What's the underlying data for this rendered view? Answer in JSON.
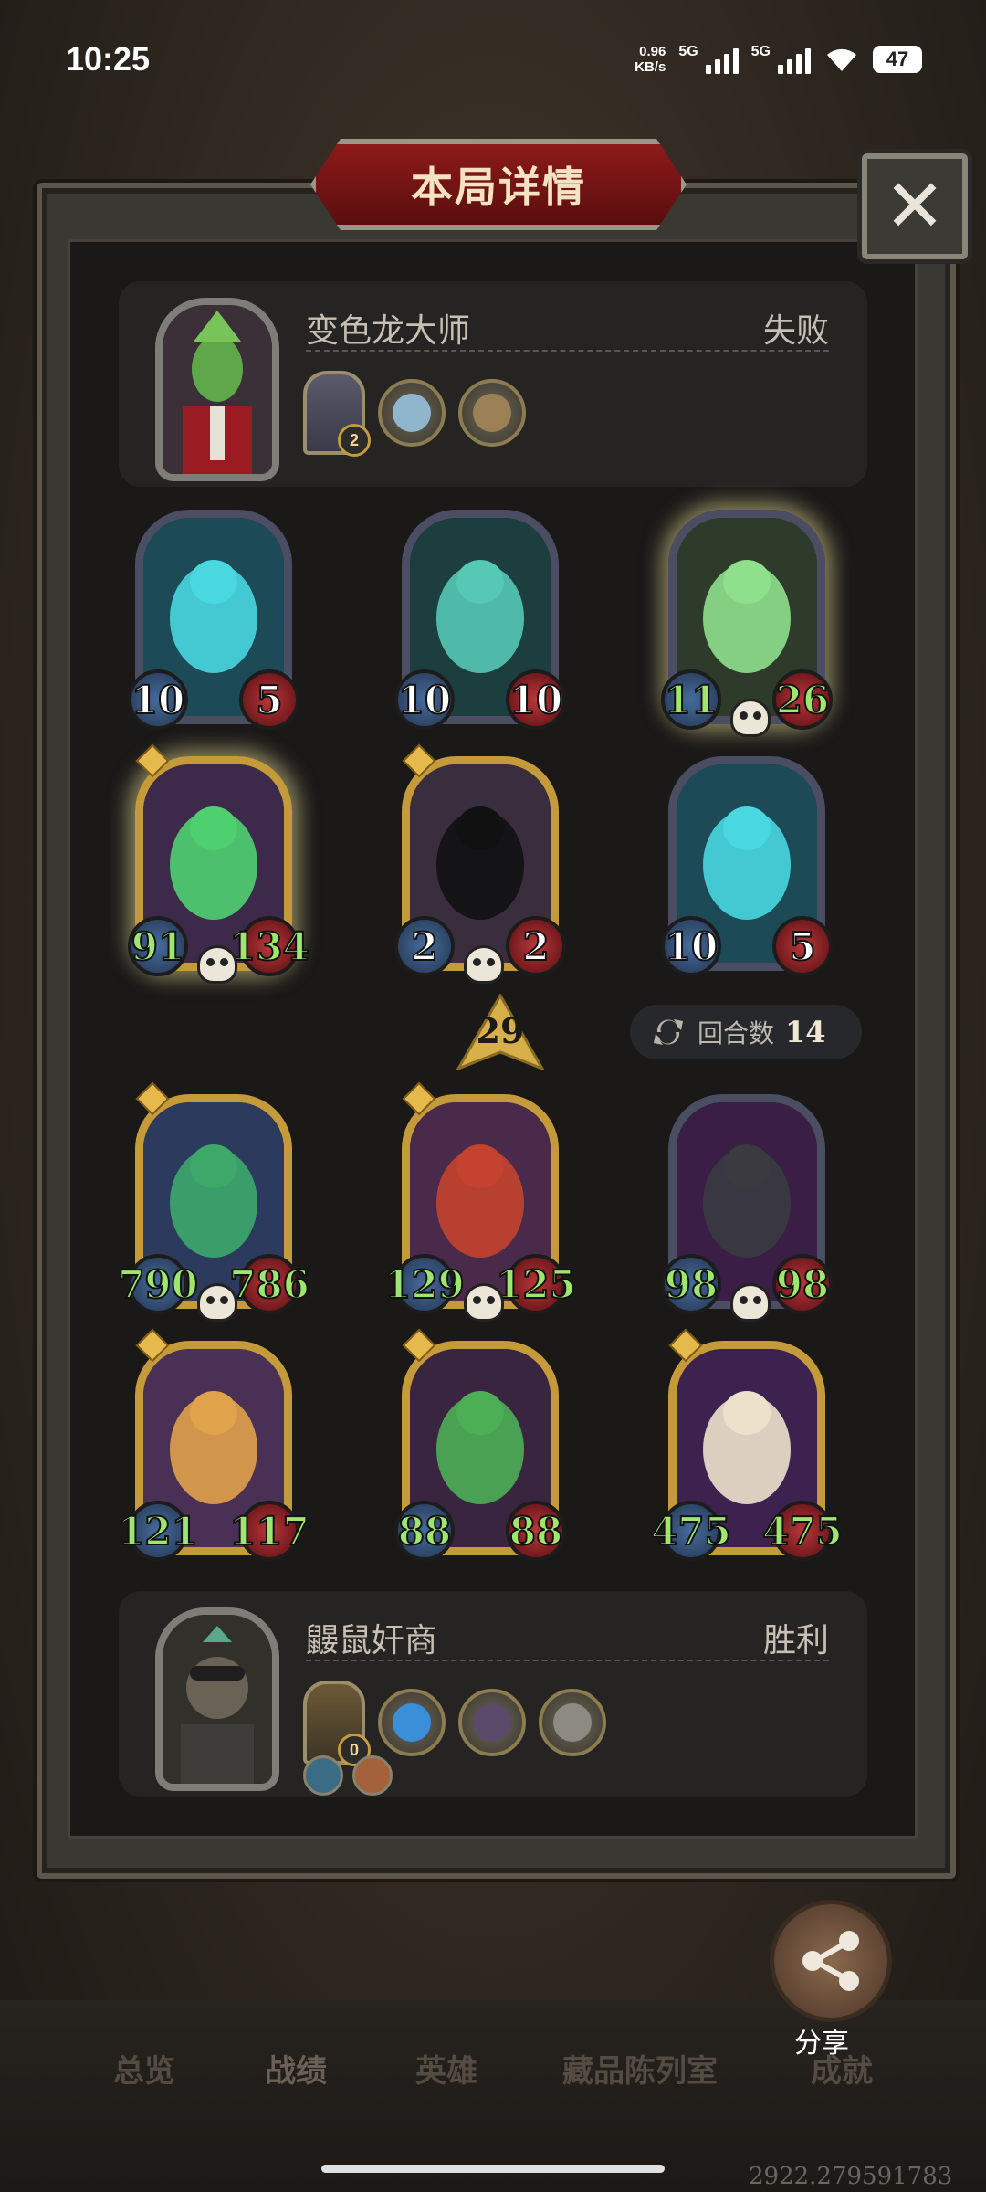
{
  "status_bar": {
    "time": "10:25",
    "net_speed": "0.96",
    "net_unit": "KB/s",
    "sim1_label": "5G",
    "sim2_label": "5G",
    "battery": "47"
  },
  "dialog": {
    "title": "本局详情",
    "close_label": "✕"
  },
  "top_player": {
    "name": "变色龙大师",
    "result": "失败",
    "card_count": "2"
  },
  "top_board": [
    {
      "attack": "10",
      "health": "5",
      "frame": "silver",
      "buffed": false,
      "dead": false,
      "art": "blue-wolf"
    },
    {
      "attack": "10",
      "health": "10",
      "frame": "silver",
      "buffed": false,
      "dead": false,
      "art": "ghost-vampire"
    },
    {
      "attack": "11",
      "health": "26",
      "frame": "silver",
      "buffed": true,
      "dead": true,
      "art": "ghost-cat"
    },
    {
      "attack": "91",
      "health": "134",
      "frame": "gold",
      "buffed": true,
      "dead": true,
      "art": "ghost-rogue"
    },
    {
      "attack": "2",
      "health": "2",
      "frame": "gold",
      "buffed": false,
      "dead": true,
      "art": "reaper"
    },
    {
      "attack": "10",
      "health": "5",
      "frame": "silver",
      "buffed": false,
      "dead": false,
      "art": "blue-wolf"
    }
  ],
  "tavern_tier": "29",
  "turns": {
    "label": "回合数",
    "value": "14"
  },
  "bottom_board": [
    {
      "attack": "790",
      "health": "786",
      "frame": "gold",
      "buffed": true,
      "dead": true,
      "art": "green-dragon"
    },
    {
      "attack": "129",
      "health": "125",
      "frame": "gold",
      "buffed": true,
      "dead": true,
      "art": "red-hair-girl"
    },
    {
      "attack": "98",
      "health": "98",
      "frame": "silver",
      "buffed": true,
      "dead": true,
      "art": "fire-boar"
    },
    {
      "attack": "121",
      "health": "117",
      "frame": "gold",
      "buffed": true,
      "dead": false,
      "art": "hamster"
    },
    {
      "attack": "88",
      "health": "88",
      "frame": "gold",
      "buffed": true,
      "dead": false,
      "art": "frog-apple"
    },
    {
      "attack": "475",
      "health": "475",
      "frame": "gold",
      "buffed": true,
      "dead": false,
      "art": "fire-horse"
    }
  ],
  "bottom_player": {
    "name": "鼹鼠奸商",
    "result": "胜利",
    "card_count": "0"
  },
  "share_label": "分享",
  "nav": {
    "tabs": [
      "总览",
      "战绩",
      "英雄",
      "藏品陈列室",
      "成就"
    ]
  },
  "watermark": "2922.279591783",
  "colors": {
    "title_plate": "#7a1515",
    "buff_text": "#9fe66e",
    "gold_frame": "#c49a3a",
    "silver_frame": "#4b4d63"
  }
}
